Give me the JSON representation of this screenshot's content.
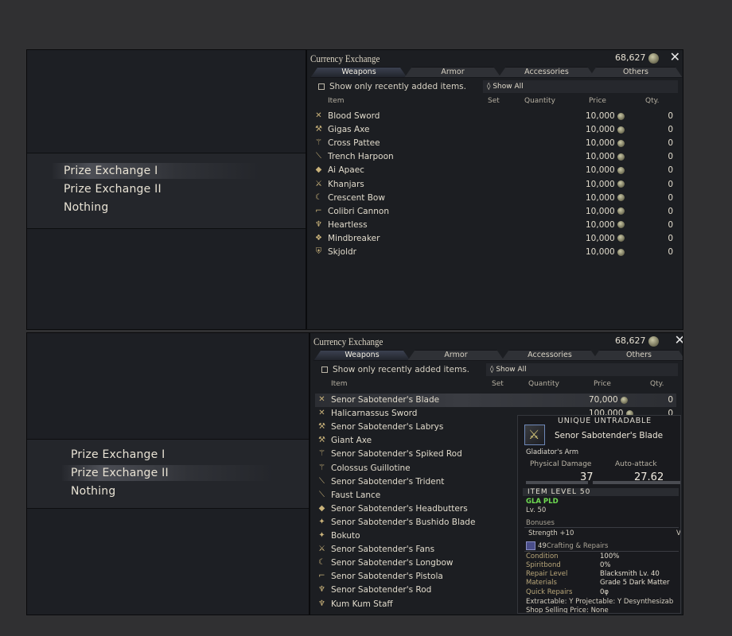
{
  "menus": [
    {
      "items": [
        "Prize Exchange I",
        "Prize Exchange II",
        "Nothing"
      ],
      "selected": 0
    },
    {
      "items": [
        "Prize Exchange I",
        "Prize Exchange II",
        "Nothing"
      ],
      "selected": 1
    }
  ],
  "shops": [
    {
      "title": "Currency Exchange",
      "gil": "68,627",
      "tabs": [
        "Weapons",
        "Armor",
        "Accessories",
        "Others"
      ],
      "active_tab": 0,
      "filter_label": "Show only recently added items.",
      "dropdown_value": "Show All",
      "headers": {
        "item": "Item",
        "set": "Set",
        "quantity": "Quantity",
        "price": "Price",
        "qty": "Qty."
      },
      "rows": [
        {
          "name": "Blood Sword",
          "price": "10,000",
          "qty": "0",
          "icon": "sword-icon"
        },
        {
          "name": "Gigas Axe",
          "price": "10,000",
          "qty": "0",
          "icon": "axe-icon"
        },
        {
          "name": "Cross Pattee",
          "price": "10,000",
          "qty": "0",
          "icon": "lance-icon"
        },
        {
          "name": "Trench Harpoon",
          "price": "10,000",
          "qty": "0",
          "icon": "harpoon-icon"
        },
        {
          "name": "Ai Apaec",
          "price": "10,000",
          "qty": "0",
          "icon": "fist-icon"
        },
        {
          "name": "Khanjars",
          "price": "10,000",
          "qty": "0",
          "icon": "dagger-icon"
        },
        {
          "name": "Crescent Bow",
          "price": "10,000",
          "qty": "0",
          "icon": "bow-icon"
        },
        {
          "name": "Colibri Cannon",
          "price": "10,000",
          "qty": "0",
          "icon": "gun-icon"
        },
        {
          "name": "Heartless",
          "price": "10,000",
          "qty": "0",
          "icon": "staff-icon"
        },
        {
          "name": "Mindbreaker",
          "price": "10,000",
          "qty": "0",
          "icon": "book-icon"
        },
        {
          "name": "Skjoldr",
          "price": "10,000",
          "qty": "0",
          "icon": "shield-icon"
        }
      ]
    },
    {
      "title": "Currency Exchange",
      "gil": "68,627",
      "tabs": [
        "Weapons",
        "Armor",
        "Accessories",
        "Others"
      ],
      "active_tab": 0,
      "filter_label": "Show only recently added items.",
      "dropdown_value": "Show All",
      "headers": {
        "item": "Item",
        "set": "Set",
        "quantity": "Quantity",
        "price": "Price",
        "qty": "Qty."
      },
      "rows": [
        {
          "name": "Senor Sabotender's Blade",
          "price": "70,000",
          "qty": "0",
          "icon": "sword-icon"
        },
        {
          "name": "Halicarnassus Sword",
          "price": "100,000",
          "qty": "0",
          "icon": "sword-icon"
        },
        {
          "name": "Senor Sabotender's Labrys",
          "price": "",
          "qty": "",
          "icon": "axe-icon"
        },
        {
          "name": "Giant Axe",
          "price": "",
          "qty": "",
          "icon": "axe-icon"
        },
        {
          "name": "Senor Sabotender's Spiked Rod",
          "price": "",
          "qty": "",
          "icon": "lance-icon"
        },
        {
          "name": "Colossus Guillotine",
          "price": "",
          "qty": "",
          "icon": "lance-icon"
        },
        {
          "name": "Senor Sabotender's Trident",
          "price": "",
          "qty": "",
          "icon": "harpoon-icon"
        },
        {
          "name": "Faust Lance",
          "price": "",
          "qty": "",
          "icon": "harpoon-icon"
        },
        {
          "name": "Senor Sabotender's Headbutters",
          "price": "",
          "qty": "",
          "icon": "fist-icon"
        },
        {
          "name": "Senor Sabotender's Bushido Blade",
          "price": "",
          "qty": "",
          "icon": "katana-icon"
        },
        {
          "name": "Bokuto",
          "price": "",
          "qty": "",
          "icon": "katana-icon"
        },
        {
          "name": "Senor Sabotender's Fans",
          "price": "",
          "qty": "",
          "icon": "dagger-icon"
        },
        {
          "name": "Senor Sabotender's Longbow",
          "price": "",
          "qty": "",
          "icon": "bow-icon"
        },
        {
          "name": "Senor Sabotender's Pistola",
          "price": "",
          "qty": "",
          "icon": "gun-icon"
        },
        {
          "name": "Senor Sabotender's Rod",
          "price": "",
          "qty": "",
          "icon": "staff-icon"
        },
        {
          "name": "Kum Kum Staff",
          "price": "",
          "qty": "",
          "icon": "staff-icon"
        }
      ]
    }
  ],
  "tooltip": {
    "tags": "UNIQUE   UNTRADABLE",
    "name": "Senor Sabotender's Blade",
    "category": "Gladiator's Arm",
    "physical_damage_label": "Physical Damage",
    "physical_damage": "37",
    "auto_attack_label": "Auto-attack",
    "auto_attack": "27.62",
    "item_level": "ITEM LEVEL 50",
    "jobs": "GLA PLD",
    "level": "Lv. 50",
    "bonuses_label": "Bonuses",
    "bonus_strength": "Strength +10",
    "bonus_cut": "V",
    "materia_count": "49",
    "crafting_label": "Crafting & Repairs",
    "condition_label": "Condition",
    "condition": "100%",
    "spiritbond_label": "Spiritbond",
    "spiritbond": "0%",
    "repair_level_label": "Repair Level",
    "repair_level": "Blacksmith Lv. 40",
    "materials_label": "Materials",
    "materials": "Grade 5 Dark Matter",
    "quick_repairs_label": "Quick Repairs",
    "quick_repairs": "0φ",
    "flags": "Extractable: Y  Projectable: Y  Desynthesizab",
    "selling_price": "Shop Selling Price: None"
  }
}
